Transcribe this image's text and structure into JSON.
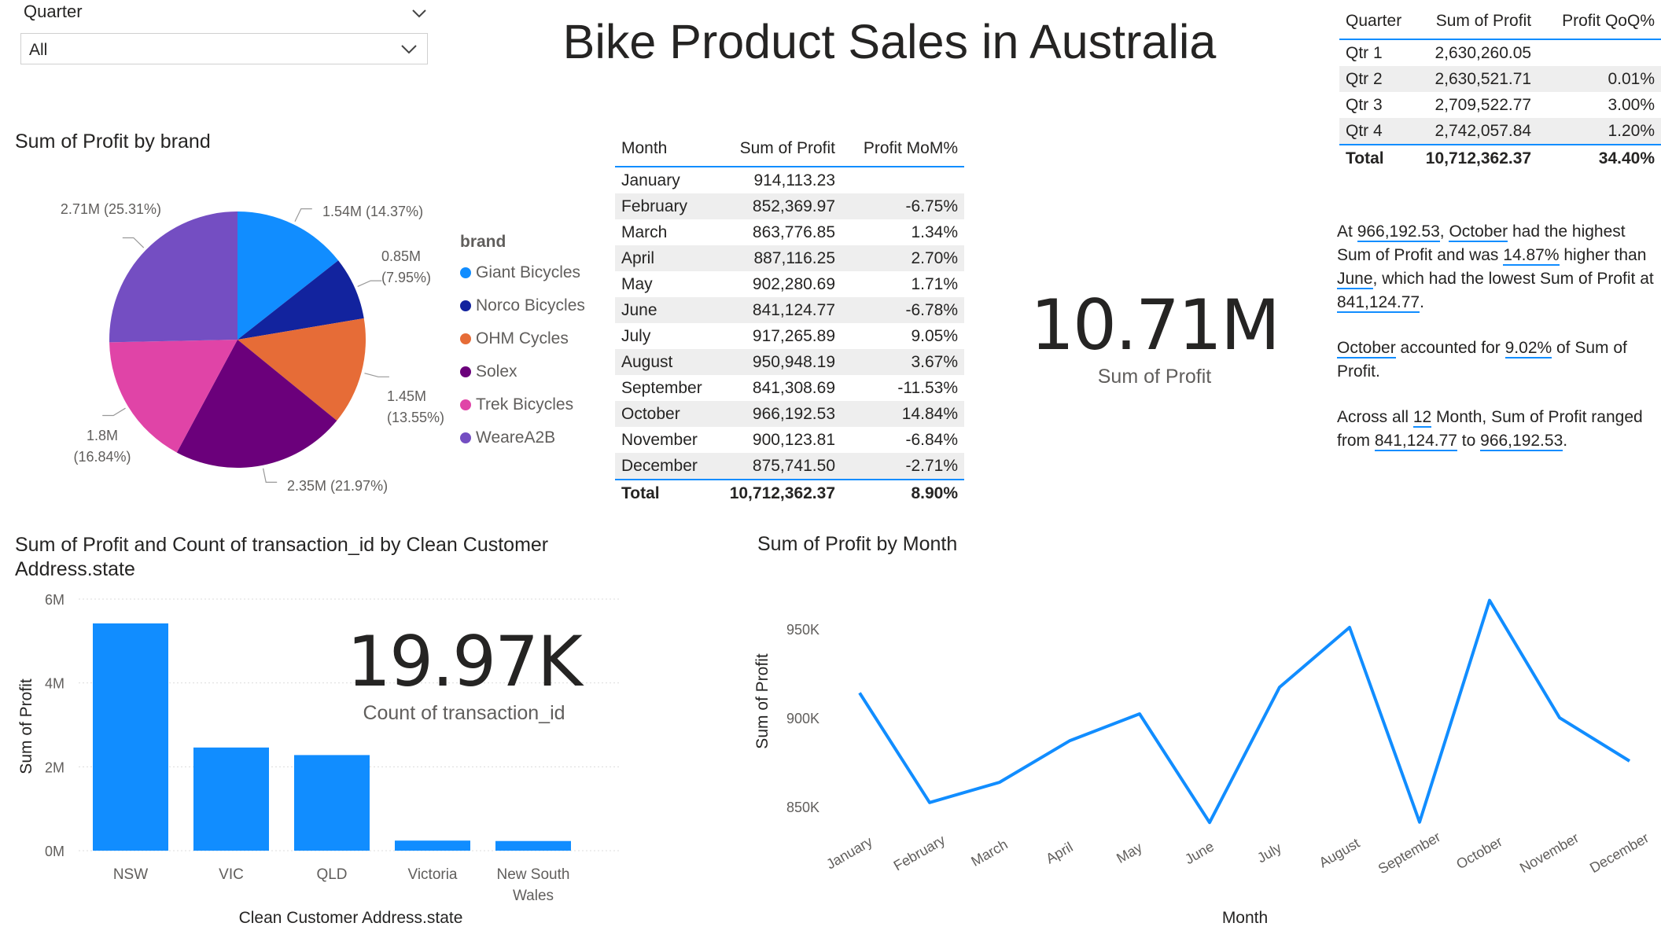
{
  "slicer": {
    "title": "Quarter",
    "value": "All"
  },
  "page_title": "Bike Product Sales in Australia",
  "pie_title": "Sum of Profit by brand",
  "pie_legend_title": "brand",
  "month_table": {
    "headers": [
      "Month",
      "Sum of Profit",
      "Profit MoM%"
    ],
    "rows": [
      [
        "January",
        "914,113.23",
        ""
      ],
      [
        "February",
        "852,369.97",
        "-6.75%"
      ],
      [
        "March",
        "863,776.85",
        "1.34%"
      ],
      [
        "April",
        "887,116.25",
        "2.70%"
      ],
      [
        "May",
        "902,280.69",
        "1.71%"
      ],
      [
        "June",
        "841,124.77",
        "-6.78%"
      ],
      [
        "July",
        "917,265.89",
        "9.05%"
      ],
      [
        "August",
        "950,948.19",
        "3.67%"
      ],
      [
        "September",
        "841,308.69",
        "-11.53%"
      ],
      [
        "October",
        "966,192.53",
        "14.84%"
      ],
      [
        "November",
        "900,123.81",
        "-6.84%"
      ],
      [
        "December",
        "875,741.50",
        "-2.71%"
      ]
    ],
    "total": [
      "Total",
      "10,712,362.37",
      "8.90%"
    ]
  },
  "quarter_table": {
    "headers": [
      "Quarter",
      "Sum of Profit",
      "Profit QoQ%"
    ],
    "rows": [
      [
        "Qtr 1",
        "2,630,260.05",
        ""
      ],
      [
        "Qtr 2",
        "2,630,521.71",
        "0.01%"
      ],
      [
        "Qtr 3",
        "2,709,522.77",
        "3.00%"
      ],
      [
        "Qtr 4",
        "2,742,057.84",
        "1.20%"
      ]
    ],
    "total": [
      "Total",
      "10,712,362.37",
      "34.40%"
    ]
  },
  "kpi_profit": {
    "value": "10.71M",
    "label": "Sum of Profit"
  },
  "kpi_count": {
    "value": "19.97K",
    "label": "Count of transaction_id"
  },
  "narrative": {
    "p1": {
      "t1": "At ",
      "v1": "966,192.53",
      "t2": ", ",
      "v2": "October",
      "t3": " had the highest Sum of Profit and was ",
      "v3": "14.87%",
      "t4": " higher than ",
      "v4": "June",
      "t5": ", which had the lowest Sum of Profit at ",
      "v5": "841,124.77",
      "t6": "."
    },
    "p2": {
      "v1": "October",
      "t1": " accounted for ",
      "v2": "9.02%",
      "t2": " of Sum of Profit."
    },
    "p3": {
      "t1": "Across all ",
      "v1": "12",
      "t2": " Month, Sum of Profit ranged from ",
      "v2": "841,124.77",
      "t3": " to ",
      "v3": "966,192.53",
      "t4": "."
    }
  },
  "bar_title": "Sum of Profit and Count of transaction_id by Clean Customer Address.state",
  "line_title": "Sum of Profit by Month",
  "colors": {
    "accent": "#118DFF",
    "pie": [
      "#118DFF",
      "#12239E",
      "#E66C37",
      "#6B007B",
      "#E044A7",
      "#744EC2"
    ]
  },
  "chart_data": [
    {
      "type": "pie",
      "title": "Sum of Profit by brand",
      "legend_title": "brand",
      "categories": [
        "Giant Bicycles",
        "Norco Bicycles",
        "OHM Cycles",
        "Solex",
        "Trek Bicycles",
        "WeareA2B"
      ],
      "values": [
        1.54,
        0.85,
        1.45,
        2.35,
        1.8,
        2.71
      ],
      "percents": [
        14.37,
        7.95,
        13.55,
        21.97,
        16.84,
        25.31
      ],
      "labels": [
        "1.54M (14.37%)",
        "0.85M (7.95%)",
        "1.45M (13.55%)",
        "2.35M (21.97%)",
        "1.8M (16.84%)",
        "2.71M (25.31%)"
      ]
    },
    {
      "type": "bar",
      "title": "Sum of Profit and Count of transaction_id by Clean Customer Address.state",
      "categories": [
        "NSW",
        "VIC",
        "QLD",
        "Victoria",
        "New South Wales"
      ],
      "values": [
        5.42,
        2.46,
        2.28,
        0.24,
        0.23
      ],
      "value_unit": "M",
      "xlabel": "Clean Customer Address.state",
      "ylabel": "Sum of Profit",
      "ylim": [
        0,
        6
      ],
      "yticks": [
        "0M",
        "2M",
        "4M",
        "6M"
      ],
      "grid": true
    },
    {
      "type": "line",
      "title": "Sum of Profit by Month",
      "categories": [
        "January",
        "February",
        "March",
        "April",
        "May",
        "June",
        "July",
        "August",
        "September",
        "October",
        "November",
        "December"
      ],
      "values": [
        914113.23,
        852369.97,
        863776.85,
        887116.25,
        902280.69,
        841124.77,
        917265.89,
        950948.19,
        841308.69,
        966192.53,
        900123.81,
        875741.5
      ],
      "xlabel": "Month",
      "ylabel": "Sum of Profit",
      "ylim": [
        835000,
        970000
      ],
      "yticks": [
        {
          "v": 850000,
          "label": "850K"
        },
        {
          "v": 900000,
          "label": "900K"
        },
        {
          "v": 950000,
          "label": "950K"
        }
      ],
      "grid": false
    }
  ]
}
